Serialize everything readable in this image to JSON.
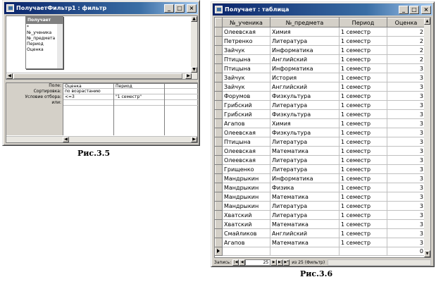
{
  "query_window": {
    "title": "ПолучаетФильтр1 : фильтр",
    "field_list": {
      "title": "Получает",
      "items": [
        "*",
        "№_ученика",
        "№_предмета",
        "Период",
        "Оценка"
      ]
    },
    "grid": {
      "row_labels": [
        "Поле:",
        "Сортировка:",
        "Условие отбора:",
        "или:"
      ],
      "columns": [
        {
          "field": "Оценка",
          "sort": "по возрастанию",
          "criteria": "<=3",
          "or": ""
        },
        {
          "field": "Период",
          "sort": "",
          "criteria": "\"1 семестр\"",
          "or": ""
        }
      ]
    }
  },
  "caption_left": "Рис.3.5",
  "table_window": {
    "title": "Получает : таблица",
    "headers": [
      "№_ученика",
      "№_предмета",
      "Период",
      "Оценка"
    ],
    "rows": [
      [
        "Олеевская",
        "Химия",
        "1 семестр",
        "2"
      ],
      [
        "Петренко",
        "Литература",
        "1 семестр",
        "2"
      ],
      [
        "Зайчук",
        "Информатика",
        "1 семестр",
        "2"
      ],
      [
        "Птицына",
        "Английский",
        "1 семестр",
        "2"
      ],
      [
        "Птицына",
        "Информатика",
        "1 семестр",
        "3"
      ],
      [
        "Зайчук",
        "История",
        "1 семестр",
        "3"
      ],
      [
        "Зайчук",
        "Английский",
        "1 семестр",
        "3"
      ],
      [
        "Форумов",
        "Физкультура",
        "1 семестр",
        "3"
      ],
      [
        "Грибский",
        "Литература",
        "1 семестр",
        "3"
      ],
      [
        "Грибский",
        "Физкультура",
        "1 семестр",
        "3"
      ],
      [
        "Агапов",
        "Химия",
        "1 семестр",
        "3"
      ],
      [
        "Олеевская",
        "Физкультура",
        "1 семестр",
        "3"
      ],
      [
        "Птицына",
        "Литература",
        "1 семестр",
        "3"
      ],
      [
        "Олеевская",
        "Математика",
        "1 семестр",
        "3"
      ],
      [
        "Олеевская",
        "Литература",
        "1 семестр",
        "3"
      ],
      [
        "Грищенко",
        "Литература",
        "1 семестр",
        "3"
      ],
      [
        "Мандрыкин",
        "Информатика",
        "1 семестр",
        "3"
      ],
      [
        "Мандрыкин",
        "Физика",
        "1 семестр",
        "3"
      ],
      [
        "Мандрыкин",
        "Математика",
        "1 семестр",
        "3"
      ],
      [
        "Мандрыкин",
        "Литература",
        "1 семестр",
        "3"
      ],
      [
        "Хватский",
        "Литература",
        "1 семестр",
        "3"
      ],
      [
        "Хватский",
        "Математика",
        "1 семестр",
        "3"
      ],
      [
        "Смайликов",
        "Английский",
        "1 семестр",
        "3"
      ],
      [
        "Агапов",
        "Математика",
        "1 семестр",
        "3"
      ]
    ],
    "new_row_value": "0",
    "nav": {
      "label": "Запись:",
      "current": "25",
      "total_text": "из 25 (Фильтр)"
    }
  },
  "caption_right": "Рис.3.6"
}
